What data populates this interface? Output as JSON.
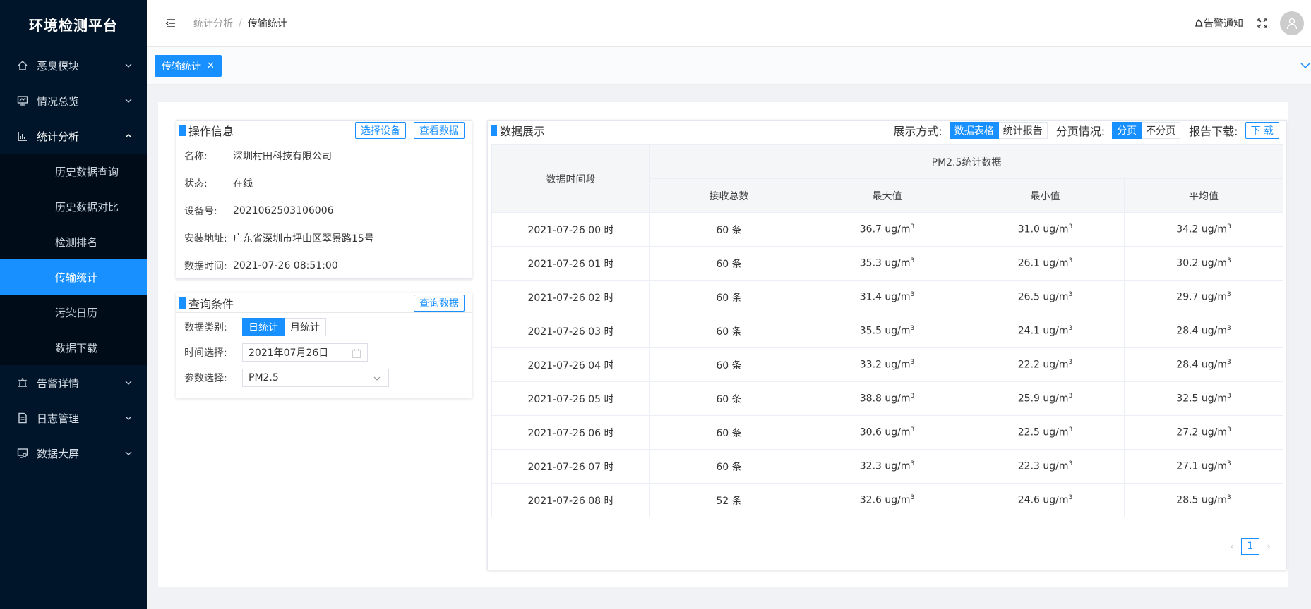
{
  "app": {
    "title": "环境检测平台"
  },
  "sidebar": {
    "items": [
      {
        "label": "恶臭模块",
        "icon": "home-icon"
      },
      {
        "label": "情况总览",
        "icon": "monitor-icon"
      },
      {
        "label": "统计分析",
        "icon": "bar-chart-icon"
      },
      {
        "label": "告警详情",
        "icon": "alarm-icon"
      },
      {
        "label": "日志管理",
        "icon": "document-icon"
      },
      {
        "label": "数据大屏",
        "icon": "screen-icon"
      }
    ],
    "submenu": [
      {
        "label": "历史数据查询"
      },
      {
        "label": "历史数据对比"
      },
      {
        "label": "检测排名"
      },
      {
        "label": "传输统计"
      },
      {
        "label": "污染日历"
      },
      {
        "label": "数据下载"
      }
    ]
  },
  "header": {
    "breadcrumb": [
      "统计分析",
      "传输统计"
    ],
    "alarm_label": "告警通知"
  },
  "tabs": [
    {
      "label": "传输统计"
    }
  ],
  "operation_panel": {
    "title": "操作信息",
    "select_button": "选择设备",
    "view_button": "查看数据",
    "rows": [
      {
        "key": "名称:",
        "value": "深圳村田科技有限公司"
      },
      {
        "key": "状态:",
        "value": "在线"
      },
      {
        "key": "设备号:",
        "value": "2021062503106006"
      },
      {
        "key": "安装地址:",
        "value": "广东省深圳市坪山区翠景路15号"
      },
      {
        "key": "数据时间:",
        "value": "2021-07-26 08:51:00"
      }
    ]
  },
  "query_panel": {
    "title": "查询条件",
    "query_button": "查询数据",
    "category_label": "数据类别:",
    "category_options": [
      "日统计",
      "月统计"
    ],
    "category_selected": "日统计",
    "time_label": "时间选择:",
    "time_value": "2021年07月26日",
    "param_label": "参数选择:",
    "param_value": "PM2.5"
  },
  "data_panel": {
    "title": "数据展示",
    "display_label": "展示方式:",
    "display_options": [
      "数据表格",
      "统计报告"
    ],
    "paging_label": "分页情况:",
    "paging_options": [
      "分页",
      "不分页"
    ],
    "download_label": "报告下载:",
    "download_button": "下 载",
    "table": {
      "col_time": "数据时间段",
      "group_header": "PM2.5统计数据",
      "columns": [
        "接收总数",
        "最大值",
        "最小值",
        "平均值"
      ],
      "rows": [
        {
          "time": "2021-07-26 00 时",
          "count": "60 条",
          "max": "36.7 ug/m",
          "min": "31.0 ug/m",
          "avg": "34.2 ug/m"
        },
        {
          "time": "2021-07-26 01 时",
          "count": "60 条",
          "max": "35.3 ug/m",
          "min": "26.1 ug/m",
          "avg": "30.2 ug/m"
        },
        {
          "time": "2021-07-26 02 时",
          "count": "60 条",
          "max": "31.4 ug/m",
          "min": "26.5 ug/m",
          "avg": "29.7 ug/m"
        },
        {
          "time": "2021-07-26 03 时",
          "count": "60 条",
          "max": "35.5 ug/m",
          "min": "24.1 ug/m",
          "avg": "28.4 ug/m"
        },
        {
          "time": "2021-07-26 04 时",
          "count": "60 条",
          "max": "33.2 ug/m",
          "min": "22.2 ug/m",
          "avg": "28.4 ug/m"
        },
        {
          "time": "2021-07-26 05 时",
          "count": "60 条",
          "max": "38.8 ug/m",
          "min": "25.9 ug/m",
          "avg": "32.5 ug/m"
        },
        {
          "time": "2021-07-26 06 时",
          "count": "60 条",
          "max": "30.6 ug/m",
          "min": "22.5 ug/m",
          "avg": "27.2 ug/m"
        },
        {
          "time": "2021-07-26 07 时",
          "count": "60 条",
          "max": "32.3 ug/m",
          "min": "22.3 ug/m",
          "avg": "27.1 ug/m"
        },
        {
          "time": "2021-07-26 08 时",
          "count": "52 条",
          "max": "32.6 ug/m",
          "min": "24.6 ug/m",
          "avg": "28.5 ug/m"
        }
      ],
      "unit_sup": "3"
    },
    "pagination": {
      "current_page": "1"
    }
  },
  "colors": {
    "primary": "#1890ff",
    "sidebar_bg": "#001529"
  }
}
